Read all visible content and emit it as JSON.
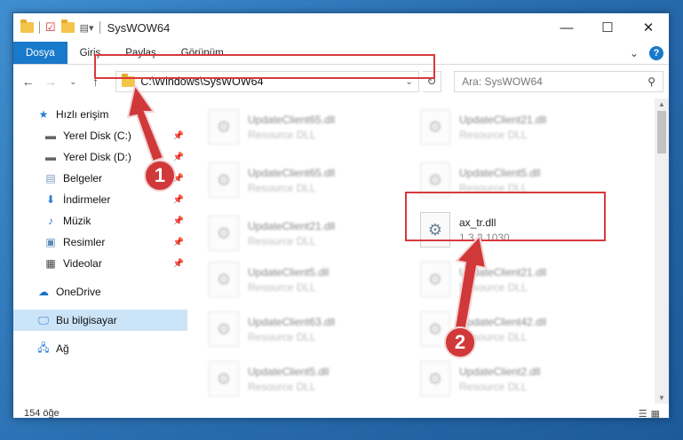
{
  "window": {
    "title": "SysWOW64",
    "controls": {
      "minimize": "—",
      "maximize": "☐",
      "close": "✕"
    }
  },
  "ribbon": {
    "tabs": [
      {
        "label": "Dosya",
        "active": true
      },
      {
        "label": "Giriş",
        "active": false
      },
      {
        "label": "Paylaş",
        "active": false
      },
      {
        "label": "Görünüm",
        "active": false
      }
    ],
    "expand_icon": "chevron-down-icon",
    "help_icon": "?"
  },
  "navigation": {
    "address": "C:\\Windows\\SysWOW64",
    "search_placeholder": "Ara: SysWOW64"
  },
  "sidebar": {
    "quick_access": "Hızlı erişim",
    "pinned": [
      {
        "label": "Yerel Disk (C:)",
        "icon": "drive-icon"
      },
      {
        "label": "Yerel Disk (D:)",
        "icon": "drive-icon"
      },
      {
        "label": "Belgeler",
        "icon": "documents-icon"
      },
      {
        "label": "İndirmeler",
        "icon": "downloads-icon"
      },
      {
        "label": "Müzik",
        "icon": "music-icon"
      },
      {
        "label": "Resimler",
        "icon": "pictures-icon"
      },
      {
        "label": "Videolar",
        "icon": "videos-icon"
      }
    ],
    "onedrive": "OneDrive",
    "this_pc": "Bu bilgisayar",
    "network": "Ağ"
  },
  "files": [
    {
      "name": "UpdateClient65.dll",
      "sub": "Resource DLL",
      "blurred": true
    },
    {
      "name": "UpdateClient21.dll",
      "sub": "Resource DLL",
      "blurred": true
    },
    {
      "name": "UpdateClient65.dll",
      "sub": "Resource DLL",
      "blurred": true
    },
    {
      "name": "UpdateClient5.dll",
      "sub": "Resource DLL",
      "blurred": true
    },
    {
      "name": "UpdateClient21.dll",
      "sub": "Resource DLL",
      "blurred": true
    },
    {
      "name": "ax_tr.dll",
      "sub": "1.3.3.1030",
      "blurred": false
    },
    {
      "name": "UpdateClient5.dll",
      "sub": "Resource DLL",
      "blurred": true
    },
    {
      "name": "UpdateClient21.dll",
      "sub": "Resource DLL",
      "blurred": true
    },
    {
      "name": "UpdateClient63.dll",
      "sub": "Resource DLL",
      "blurred": true
    },
    {
      "name": "UpdateClient42.dll",
      "sub": "Resource DLL",
      "blurred": true
    },
    {
      "name": "UpdateClient5.dll",
      "sub": "Resource DLL",
      "blurred": true
    },
    {
      "name": "UpdateClient2.dll",
      "sub": "Resource DLL",
      "blurred": true
    }
  ],
  "status": {
    "count": "154 öğe"
  },
  "annotations": {
    "marker1": "1",
    "marker2": "2",
    "color": "#d0383a"
  }
}
